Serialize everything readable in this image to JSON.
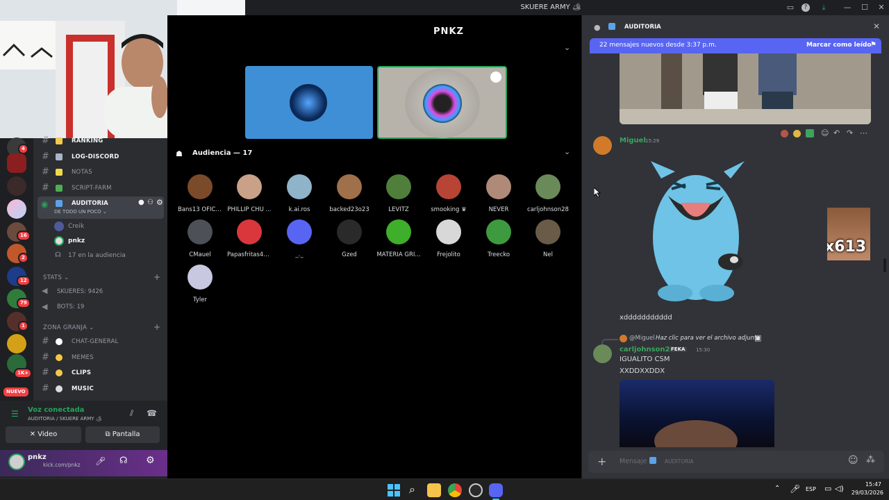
{
  "window": {
    "title": "SKUERE ARMY 🏕"
  },
  "stage": {
    "logo": "PNKZ",
    "audience_header": "Audiencia — 17"
  },
  "audience": [
    {
      "name": "Bans13 OFICI..."
    },
    {
      "name": "PHILLIP CHU ..."
    },
    {
      "name": "k.ai.ros"
    },
    {
      "name": "backed23o23"
    },
    {
      "name": "LEVITZ"
    },
    {
      "name": "smooking ♛"
    },
    {
      "name": "NEVER"
    },
    {
      "name": "carljohnson28"
    },
    {
      "name": "CMauel"
    },
    {
      "name": "Papasfritas4k..."
    },
    {
      "name": "_._"
    },
    {
      "name": "Gzed"
    },
    {
      "name": "MATERIA GRI..."
    },
    {
      "name": "Frejolito"
    },
    {
      "name": "Treecko"
    },
    {
      "name": "Nel"
    },
    {
      "name": "Tyler"
    }
  ],
  "sidebar": {
    "channels": {
      "ranking": "RANKING",
      "log": "LOG-DISCORD",
      "notas": "NOTAS",
      "script": "SCRIPT-FARM",
      "auditoria": "AUDITORIA",
      "auditoria_sub": "DE TODO UN POCO ⌄",
      "chat_general": "CHAT-GENERAL",
      "memes": "MEMES",
      "clips": "CLIPS",
      "music": "MUSIC"
    },
    "voice_members": {
      "m1": "Creik",
      "m2": "pnkz",
      "m3": "17 en la audiencia"
    },
    "stats_category": "STATS ⌄",
    "stats": {
      "skueres": "SKUERES: 9426",
      "bots": "BOTS: 19"
    },
    "granja_category": "ZONA GRANJA ⌄"
  },
  "rail_badges": {
    "b1": "4",
    "b2": "16",
    "b3": "2",
    "b4": "12",
    "b5": "79",
    "b6": "1",
    "b7": "1K+",
    "nuevo": "NUEVO"
  },
  "voice": {
    "status": "Voz conectada",
    "location": "AUDITORIA / SKUERE ARMY 🏕",
    "video_btn": "Video",
    "screen_btn": "Pantalla"
  },
  "user": {
    "name": "pnkz",
    "status": "kick.com/pnkz"
  },
  "chat": {
    "header": "AUDITORIA",
    "banner_left": "22 mensajes nuevos desde 3:37 p.m.",
    "banner_right": "Marcar como leído",
    "msg1_author": "Miguel",
    "msg1_time": "15:29",
    "counter": "x613",
    "msg1_text": "xddddddddddd",
    "reply_author": "@Miguel",
    "reply_text": "Haz clic para ver el archivo adjunto",
    "msg2_author": "carljohnson28",
    "msg2_tag": "FEKA",
    "msg2_time": "15:30",
    "msg2_line1": "IGUALITO CSM",
    "msg2_line2": "XXDDXXDDX",
    "input_placeholder": "Mensaje",
    "input_channel": "AUDITORIA"
  },
  "taskbar": {
    "lang": "ESP",
    "time": "15:47",
    "date": "29/03/2026"
  },
  "colors": {
    "accent": "#5865f2",
    "green": "#23a55a",
    "red": "#f23f43",
    "user_green": "#3ba55c"
  }
}
